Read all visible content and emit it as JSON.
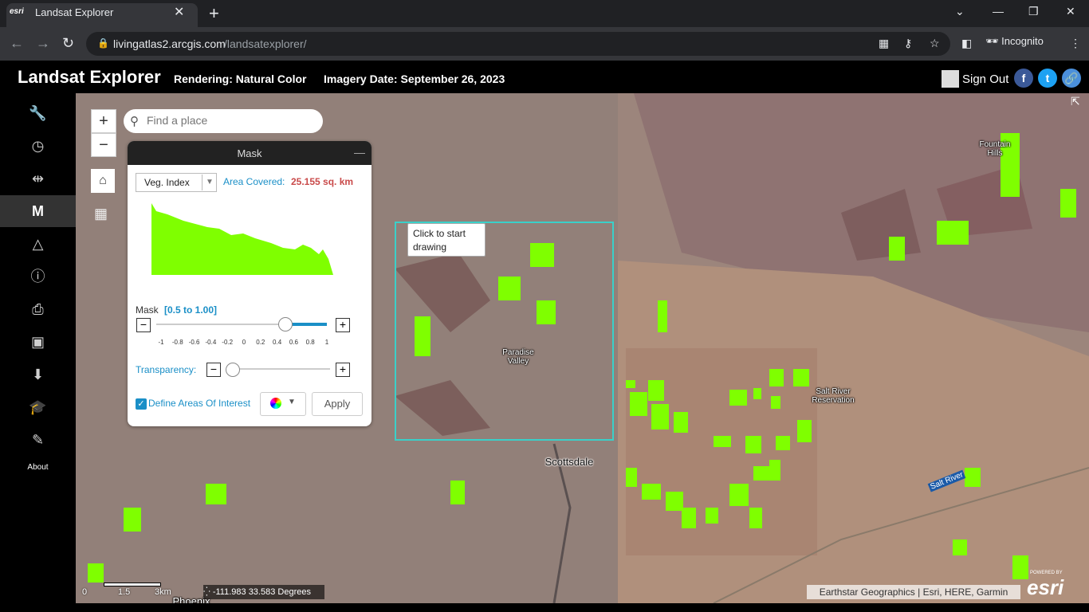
{
  "browser": {
    "tab_title": "Landsat Explorer",
    "favicon_text": "esri",
    "url_host": "livingatlas2.arcgis.com",
    "url_path": "/landsatexplorer/",
    "profile_label": "Incognito"
  },
  "header": {
    "app_title": "Landsat Explorer",
    "rendering": "Rendering: Natural Color",
    "imagery_date": "Imagery Date: September 26, 2023",
    "sign_out": "Sign Out",
    "social": [
      "facebook-icon",
      "twitter-icon",
      "link-icon"
    ]
  },
  "sidebar": {
    "items": [
      {
        "name": "wrench-icon",
        "glyph": "🔧"
      },
      {
        "name": "clock-icon",
        "glyph": "◷"
      },
      {
        "name": "swipe-icon",
        "glyph": "⇹"
      },
      {
        "name": "mask-icon",
        "glyph": "M",
        "active": true
      },
      {
        "name": "change-detection-icon",
        "glyph": "△"
      },
      {
        "name": "info-icon",
        "glyph": "ⓘ"
      },
      {
        "name": "export-icon",
        "glyph": "⎙"
      },
      {
        "name": "save-icon",
        "glyph": "▣"
      },
      {
        "name": "download-icon",
        "glyph": "⬇"
      },
      {
        "name": "education-icon",
        "glyph": "🎓"
      },
      {
        "name": "story-icon",
        "glyph": "✎"
      }
    ],
    "about_label": "About"
  },
  "map": {
    "search_placeholder": "Find a place",
    "zoom_in": "+",
    "zoom_out": "−",
    "labels": {
      "fountain_hills": "Fountain Hills",
      "paradise_valley": "Paradise Valley",
      "salt_river_reservation": "Salt River Reservation",
      "scottsdale": "Scottsdale",
      "salt_river": "Salt River",
      "phoenix": "Phoenix"
    },
    "draw_tooltip": "Click to start drawing",
    "scale": {
      "ticks": [
        "0",
        "1.5",
        "3km"
      ]
    },
    "coordinates": "-111.983 33.583 Degrees",
    "attribution": "Earthstar Geographics | Esri, HERE, Garmin",
    "esri_logo": "esri",
    "powered_by": "POWERED BY"
  },
  "mask_panel": {
    "title": "Mask",
    "index_select": "Veg. Index",
    "area_label": "Area Covered:",
    "area_value": "25.155 sq. km",
    "mask_label": "Mask",
    "mask_range": "[0.5 to 1.00]",
    "mask_slider_value": 0.5,
    "mask_ticks": [
      "-1",
      "-0.8",
      "-0.6",
      "-0.4",
      "-0.2",
      "0",
      "0.2",
      "0.4",
      "0.6",
      "0.8",
      "1"
    ],
    "transparency_label": "Transparency:",
    "transparency_value": 0.0,
    "define_aoi_label": "Define Areas Of Interest",
    "define_aoi_checked": true,
    "apply_label": "Apply",
    "histogram_color": "#7fff00"
  },
  "colors": {
    "accent": "#1a8fc7",
    "area_value": "#c94a4a",
    "draw_box": "#3ad0c9",
    "vegetation": "#7fff00"
  }
}
